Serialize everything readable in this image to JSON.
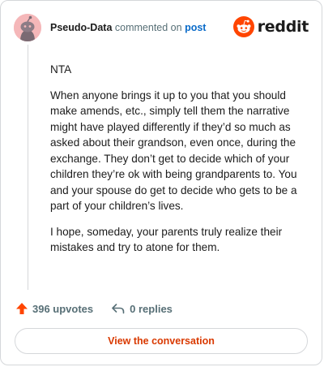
{
  "header": {
    "username": "Pseudo-Data",
    "verb": "commented on",
    "target": "post",
    "logo_text": "reddit"
  },
  "comment": {
    "paragraphs": [
      "NTA",
      "When anyone brings it up to you that you should make amends, etc., simply tell them the narrative might have played differently if they’d so much as asked about their grandson, even once, during the exchange. They don’t get to decide which of your children they’re ok with being grandparents to. You and your spouse do get to decide who gets to be a part of your children’s lives.",
      "I hope, someday, your parents truly realize their mistakes and try to atone for them."
    ]
  },
  "actions": {
    "upvotes": "396 upvotes",
    "replies": "0 replies"
  },
  "cta": {
    "label": "View the conversation"
  },
  "colors": {
    "brand": "#ff4500",
    "link": "#0a6bc9",
    "cta_text": "#d93900",
    "avatar_bg": "#f5b7b9"
  }
}
